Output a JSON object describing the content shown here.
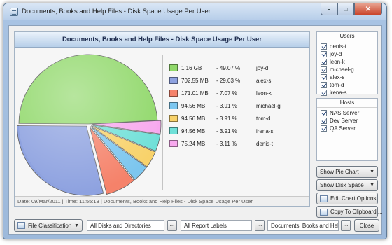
{
  "window": {
    "title": "Documents, Books and Help Files - Disk Space Usage Per User"
  },
  "chart": {
    "title": "Documents, Books and Help Files - Disk Space Usage Per User",
    "footer": "Date: 09/Mar/2011 | Time: 11:55:13 | Documents, Books and Help Files - Disk Space Usage Per User"
  },
  "chart_data": {
    "type": "pie",
    "title": "Documents, Books and Help Files - Disk Space Usage Per User",
    "slices": [
      {
        "label": "joy-d",
        "size": "1.16 GB",
        "pct_text": "- 49.07 %",
        "value": 49.07,
        "color": "#90d86a"
      },
      {
        "label": "alex-s",
        "size": "702.55 MB",
        "pct_text": "- 29.03 %",
        "value": 29.03,
        "color": "#8ea2e0"
      },
      {
        "label": "leon-k",
        "size": "171.01 MB",
        "pct_text": "- 7.07 %",
        "value": 7.07,
        "color": "#f5826a"
      },
      {
        "label": "michael-g",
        "size": "94.56 MB",
        "pct_text": "- 3.91 %",
        "value": 3.91,
        "color": "#7cc6ef"
      },
      {
        "label": "tom-d",
        "size": "94.56 MB",
        "pct_text": "- 3.91 %",
        "value": 3.91,
        "color": "#f8d26a"
      },
      {
        "label": "irena-s",
        "size": "94.56 MB",
        "pct_text": "- 3.91 %",
        "value": 3.91,
        "color": "#6fe0d8"
      },
      {
        "label": "denis-t",
        "size": "75.24 MB",
        "pct_text": "- 3.11 %",
        "value": 3.11,
        "color": "#f7a8ee"
      }
    ]
  },
  "users": {
    "title": "Users",
    "items": [
      "denis-t",
      "joy-d",
      "leon-k",
      "michael-g",
      "alex-s",
      "tom-d",
      "irena-s"
    ]
  },
  "hosts": {
    "title": "Hosts",
    "items": [
      "NAS Server",
      "Dev Server",
      "QA Server"
    ]
  },
  "buttons": {
    "show_pie": "Show Pie Chart",
    "show_disk": "Show Disk Space",
    "edit_chart": "Edit Chart Options ...",
    "copy_clip": "Copy To Clipboard ..."
  },
  "bottom": {
    "file_class": "File Classification",
    "disks": "All Disks and Directories",
    "dots": "...",
    "labels": "All Report Labels",
    "category": "Documents, Books and Help Files",
    "close": "Close"
  }
}
